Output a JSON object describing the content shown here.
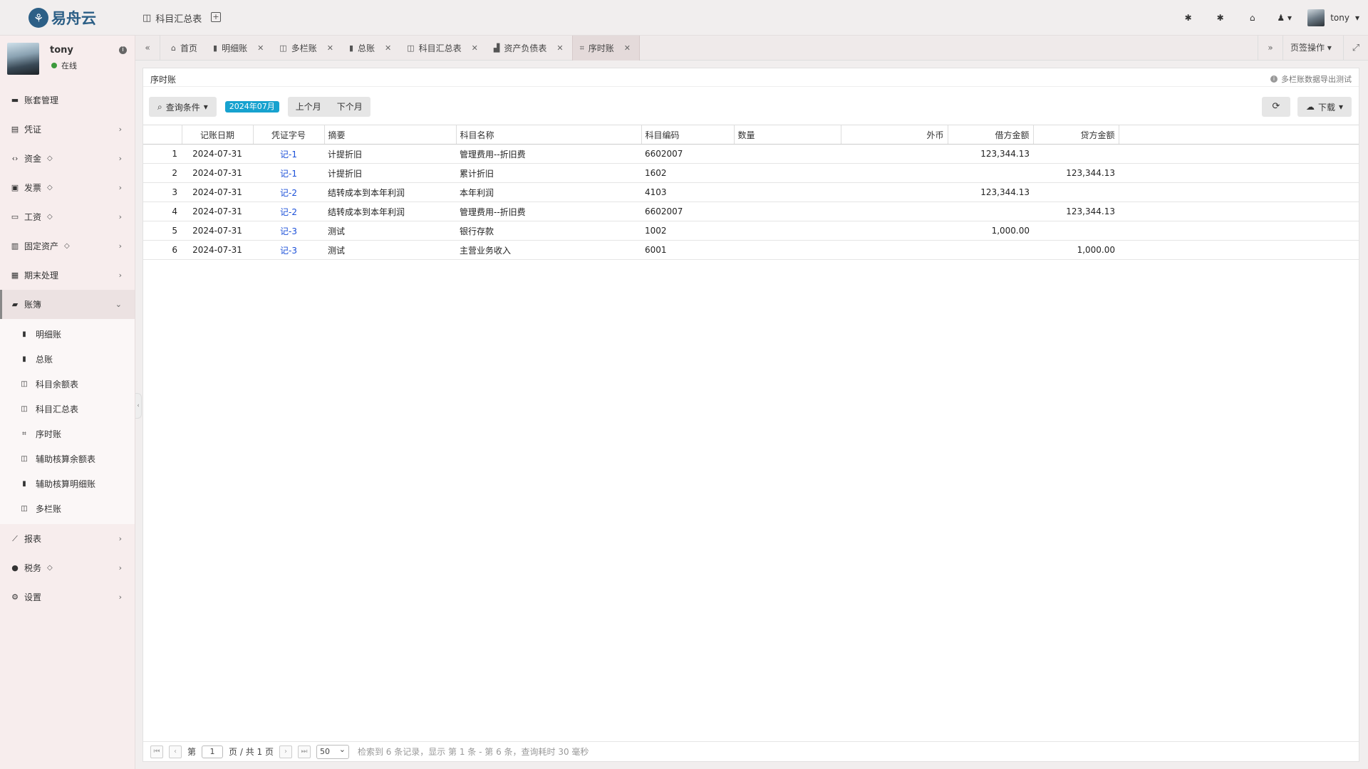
{
  "app": {
    "logo_text": "易舟云"
  },
  "topbar": {
    "open_doc_label": "科目汇总表",
    "user_name": "tony",
    "icons": [
      "bug-icon",
      "bug-icon",
      "home-icon",
      "user-icon"
    ]
  },
  "sidebar": {
    "user": {
      "name": "tony",
      "status": "在线"
    },
    "menu": [
      {
        "label": "账套管理",
        "icon": "book-icon",
        "premium": false,
        "expandable": false
      },
      {
        "label": "凭证",
        "icon": "voucher-icon",
        "premium": false,
        "expandable": true
      },
      {
        "label": "资金",
        "icon": "code-icon",
        "premium": true,
        "expandable": true
      },
      {
        "label": "发票",
        "icon": "image-icon",
        "premium": true,
        "expandable": true
      },
      {
        "label": "工资",
        "icon": "card-icon",
        "premium": true,
        "expandable": true
      },
      {
        "label": "固定资产",
        "icon": "building-icon",
        "premium": true,
        "expandable": true
      },
      {
        "label": "期末处理",
        "icon": "calendar-icon",
        "premium": false,
        "expandable": true
      },
      {
        "label": "账簿",
        "icon": "ledger-icon",
        "premium": false,
        "expandable": true,
        "active": true
      }
    ],
    "submenu": [
      {
        "label": "明细账",
        "icon": "bookmark-icon"
      },
      {
        "label": "总账",
        "icon": "bookmark-icon"
      },
      {
        "label": "科目余额表",
        "icon": "columns-icon"
      },
      {
        "label": "科目汇总表",
        "icon": "columns-icon"
      },
      {
        "label": "序时账",
        "icon": "crop-icon"
      },
      {
        "label": "辅助核算余额表",
        "icon": "columns-icon"
      },
      {
        "label": "辅助核算明细账",
        "icon": "bookmark-icon"
      },
      {
        "label": "多栏账",
        "icon": "columns-icon"
      }
    ],
    "menu_after": [
      {
        "label": "报表",
        "icon": "chart-icon",
        "premium": false
      },
      {
        "label": "税务",
        "icon": "tax-icon",
        "premium": true
      },
      {
        "label": "设置",
        "icon": "gear-icon",
        "premium": false
      }
    ]
  },
  "tabs": [
    {
      "label": "首页",
      "icon": "home-icon",
      "closable": false
    },
    {
      "label": "明细账",
      "icon": "bookmark-icon",
      "closable": true
    },
    {
      "label": "多栏账",
      "icon": "columns-icon",
      "closable": true
    },
    {
      "label": "总账",
      "icon": "bookmark-icon",
      "closable": true
    },
    {
      "label": "科目汇总表",
      "icon": "columns-icon",
      "closable": true
    },
    {
      "label": "资产负债表",
      "icon": "chart-icon",
      "closable": true
    },
    {
      "label": "序时账",
      "icon": "crop-icon",
      "closable": true,
      "active": true
    }
  ],
  "tab_ops_label": "页签操作",
  "panel": {
    "title": "序时账",
    "note": "多栏账数据导出测试"
  },
  "toolbar": {
    "query_label": "查询条件",
    "period": "2024年07月",
    "prev_month": "上个月",
    "next_month": "下个月",
    "download_label": "下载"
  },
  "table": {
    "headers": [
      "",
      "记账日期",
      "凭证字号",
      "摘要",
      "科目名称",
      "科目编码",
      "数量",
      "外币",
      "借方金额",
      "贷方金额"
    ],
    "rows": [
      {
        "n": "1",
        "date": "2024-07-31",
        "voucher": "记-1",
        "summary": "计提折旧",
        "account": "管理费用--折旧费",
        "code": "6602007",
        "qty": "",
        "fx": "",
        "debit": "123,344.13",
        "credit": ""
      },
      {
        "n": "2",
        "date": "2024-07-31",
        "voucher": "记-1",
        "summary": "计提折旧",
        "account": "累计折旧",
        "code": "1602",
        "qty": "",
        "fx": "",
        "debit": "",
        "credit": "123,344.13"
      },
      {
        "n": "3",
        "date": "2024-07-31",
        "voucher": "记-2",
        "summary": "结转成本到本年利润",
        "account": "本年利润",
        "code": "4103",
        "qty": "",
        "fx": "",
        "debit": "123,344.13",
        "credit": ""
      },
      {
        "n": "4",
        "date": "2024-07-31",
        "voucher": "记-2",
        "summary": "结转成本到本年利润",
        "account": "管理费用--折旧费",
        "code": "6602007",
        "qty": "",
        "fx": "",
        "debit": "",
        "credit": "123,344.13"
      },
      {
        "n": "5",
        "date": "2024-07-31",
        "voucher": "记-3",
        "summary": "测试",
        "account": "银行存款",
        "code": "1002",
        "qty": "",
        "fx": "",
        "debit": "1,000.00",
        "credit": ""
      },
      {
        "n": "6",
        "date": "2024-07-31",
        "voucher": "记-3",
        "summary": "测试",
        "account": "主营业务收入",
        "code": "6001",
        "qty": "",
        "fx": "",
        "debit": "",
        "credit": "1,000.00"
      }
    ]
  },
  "pager": {
    "page_prefix": "第",
    "page_value": "1",
    "page_suffix": "页 / 共 1 页",
    "page_size": "50",
    "info": "检索到 6 条记录，显示 第 1 条 - 第 6 条，查询耗时 30 毫秒"
  },
  "colors": {
    "link": "#1a4fd8",
    "badge": "#17a2cf",
    "online": "#3c9a3c"
  }
}
